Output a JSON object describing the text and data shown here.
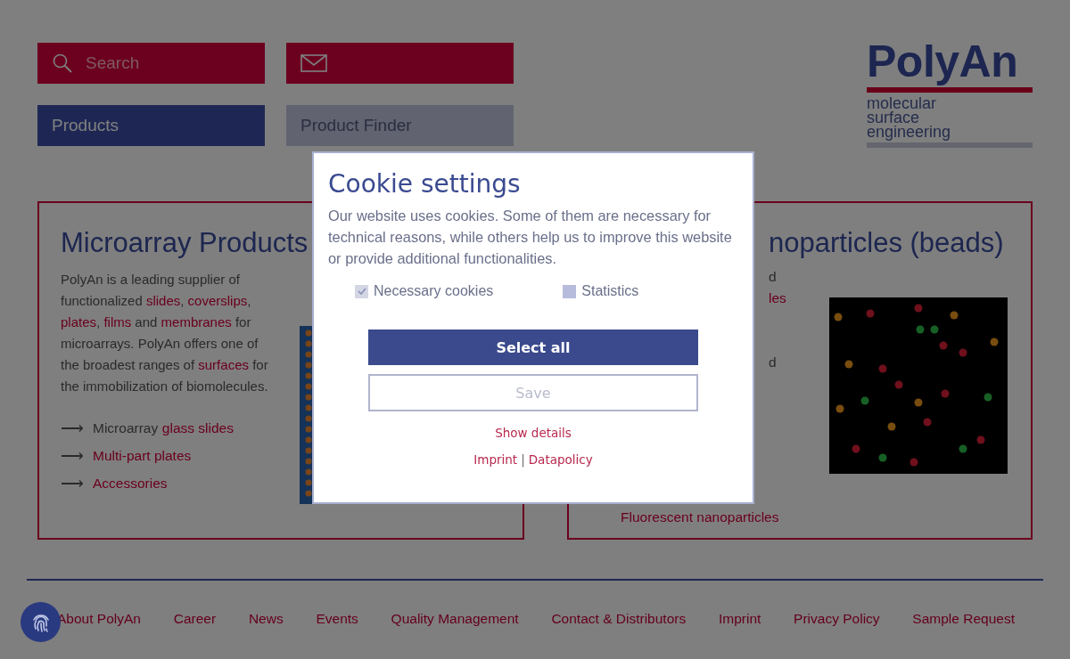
{
  "header": {
    "search_button": {
      "label": "Search"
    },
    "nav": [
      {
        "label": "Products",
        "selected": true
      },
      {
        "label": "Product Finder",
        "selected": false
      }
    ]
  },
  "logo": {
    "name": "PolyAn",
    "tagline": [
      "molecular",
      "surface",
      "engineering"
    ]
  },
  "left_card": {
    "title": "Microarray Products",
    "description": [
      {
        "text": "PolyAn is a leading supplier of functionalized ",
        "link": false
      },
      {
        "text": "slides",
        "link": true
      },
      {
        "text": ", ",
        "link": false
      },
      {
        "text": "coverslips",
        "link": true
      },
      {
        "text": ", ",
        "link": false
      },
      {
        "text": "plates",
        "link": true
      },
      {
        "text": ", ",
        "link": false
      },
      {
        "text": "films",
        "link": true
      },
      {
        "text": " and ",
        "link": false
      },
      {
        "text": "membranes",
        "link": true
      },
      {
        "text": " for microarrays. PolyAn offers one of the broadest ranges of ",
        "link": false
      },
      {
        "text": "surfaces",
        "link": true
      },
      {
        "text": " for the immobilization of biomolecules.",
        "link": false
      }
    ],
    "links": [
      {
        "arrow": "⟶",
        "prefix": "Microarray",
        "label": "glass slides"
      },
      {
        "arrow": "⟶",
        "label": "Multi-part plates"
      },
      {
        "arrow": "⟶",
        "label": "Accessories"
      }
    ]
  },
  "right_card": {
    "title": "noparticles (beads)",
    "fragments": [
      {
        "text": "d",
        "link": false
      },
      {
        "text": "les",
        "link": true
      },
      {
        "text": "d",
        "link": false
      }
    ],
    "bottom_link": "Fluorescent nanoparticles"
  },
  "dialog": {
    "title": "Cookie settings",
    "text": "Our website uses cookies. Some of them are necessary for technical reasons, while others help us to improve this website or provide additional functionalities.",
    "options": [
      {
        "label": "Necessary cookies",
        "checked": true,
        "disabled": true
      },
      {
        "label": "Statistics",
        "checked": false,
        "disabled": false
      }
    ],
    "primary_button": "Select all",
    "secondary_button": "Save",
    "details_link": "Show details",
    "links": [
      "Imprint",
      "Datapolicy"
    ],
    "separator": "|"
  },
  "footer": {
    "links": [
      "About PolyAn",
      "Career",
      "News",
      "Events",
      "Quality Management",
      "Contact & Distributors",
      "Imprint",
      "Privacy Policy",
      "Sample Request"
    ]
  }
}
